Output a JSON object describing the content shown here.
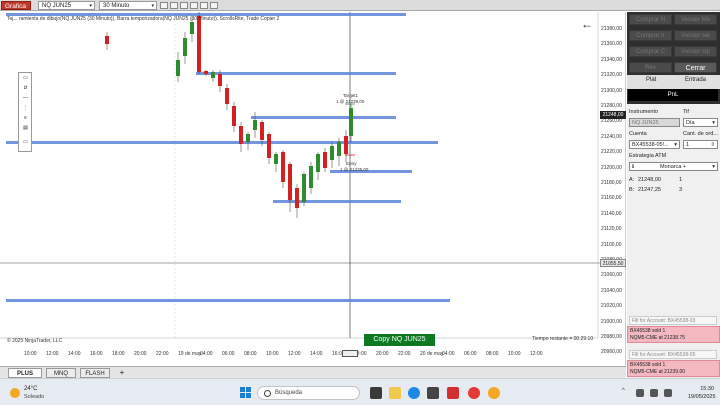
{
  "toolbar": {
    "chart_tab": "Grafica",
    "instrument": "NQ JUN25",
    "period": "30 Minuto"
  },
  "chart": {
    "info_line": "Tej... ramienta de dibujo(NQ JUN25 (30 Minuto)), Barra temporizadora(NQ JUN25 (30 Minuto)), ScrollsRite, Trade Copier 2",
    "copyright": "© 2025 NinjaTrader, LLC",
    "remaining_time": "Tiempo restante = 00:29:10",
    "copy_button": "Copy NQ JUN25",
    "target_label": "Target1",
    "target_detail": "1 @ 21239,00",
    "entry_label": "Entry",
    "entry_detail": "1 @ 21235,00",
    "current_price": "21055,50",
    "price_labels": [
      "21380,00",
      "21360,00",
      "21340,00",
      "21320,00",
      "21300,00",
      "21280,00",
      "21260,00",
      "21240,00",
      "21220,00",
      "21200,00",
      "21180,00",
      "21160,00",
      "21140,00",
      "21120,00",
      "21100,00",
      "21080,00",
      "21060,00",
      "21040,00",
      "21020,00",
      "21000,00",
      "20980,00",
      "20960,00"
    ],
    "price_marker": "21248,00",
    "time_labels": [
      "10:00",
      "12:00",
      "14:00",
      "16:00",
      "18:00",
      "20:00",
      "22:00",
      "19 de may.",
      "04:00",
      "06:00",
      "08:00",
      "10:00",
      "12:00",
      "14:00",
      "16:00",
      "18:00",
      "20:00",
      "22:00",
      "20 de may.",
      "04:00",
      "06:00",
      "08:00",
      "10:00",
      "12:00"
    ]
  },
  "tabs": {
    "plus": "PLUS",
    "mnq": "MNQ",
    "flash": "FLASH",
    "add": "+"
  },
  "panel": {
    "buttons": [
      "Comprar N",
      "Vender Me",
      "Comprar Ir",
      "Vender set",
      "Comprar C",
      "Vender stp",
      "Rev",
      "Cerrar"
    ],
    "tab_flat": "Plat",
    "tab_entry": "Entrada",
    "pnl": "PnL",
    "instrument_label": "Instrumento",
    "instrument_value": "NQ JUN25",
    "tif_label": "Tif",
    "tif_value": "Día",
    "account_label": "Cuenta",
    "account_value": "BX45538-05!...",
    "qty_label": "Cant. de ord...",
    "qty_value": "1",
    "atm_label": "Estrategia ATM",
    "atm_value": "Monarca +",
    "ask_label": "A:",
    "ask_value": "21248,00",
    "ask_size": "1",
    "bid_label": "B:",
    "bid_value": "21247,25",
    "bid_size": "3",
    "fills": [
      {
        "header": "Fill for Account: BX45538-03",
        "line1": "BX45538 sold 1",
        "line2": "NQM5-CME at 21238.75"
      },
      {
        "header": "Fill for Account: BX45538-05",
        "line1": "BX45538 sold 1",
        "line2": "NQM5-CME at 21239.00"
      }
    ]
  },
  "taskbar": {
    "weather_temp": "24°C",
    "weather_desc": "Soleado",
    "search": "Búsqueda",
    "time": "15:30",
    "date": "19/05/2025"
  },
  "colors": {
    "up": "#2e8b2e",
    "down": "#d42020",
    "level_line": "#5b83d9",
    "accent": "#c0392b"
  }
}
